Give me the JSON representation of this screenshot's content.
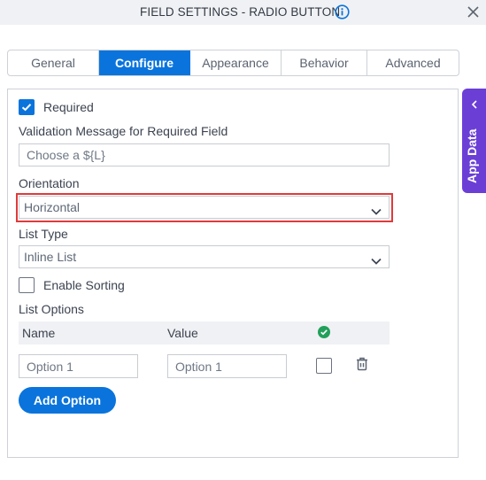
{
  "header": {
    "title": "FIELD SETTINGS - RADIO BUTTON",
    "info_icon": "info-circle-icon",
    "close_icon": "close-icon"
  },
  "tabs": [
    {
      "label": "General",
      "active": false
    },
    {
      "label": "Configure",
      "active": true
    },
    {
      "label": "Appearance",
      "active": false
    },
    {
      "label": "Behavior",
      "active": false
    },
    {
      "label": "Advanced",
      "active": false
    }
  ],
  "side_panel": {
    "label": "App Data",
    "icon": "chevron-left-icon",
    "color": "#6b3fd6"
  },
  "form": {
    "required": {
      "label": "Required",
      "checked": true
    },
    "validation_message": {
      "label": "Validation Message for Required Field",
      "value": "Choose a ${L}"
    },
    "orientation": {
      "label": "Orientation",
      "value": "Horizontal"
    },
    "list_type": {
      "label": "List Type",
      "value": "Inline List"
    },
    "enable_sorting": {
      "label": "Enable Sorting",
      "checked": false
    },
    "list_options": {
      "label": "List Options",
      "columns": {
        "name": "Name",
        "value": "Value",
        "default_icon": "check-circle-icon"
      },
      "rows": [
        {
          "name": "Option 1",
          "value": "Option 1",
          "default": false
        }
      ]
    },
    "add_option_label": "Add Option"
  },
  "colors": {
    "accent": "#0a74dc",
    "highlight": "#e03a3a",
    "success": "#22a05b"
  }
}
